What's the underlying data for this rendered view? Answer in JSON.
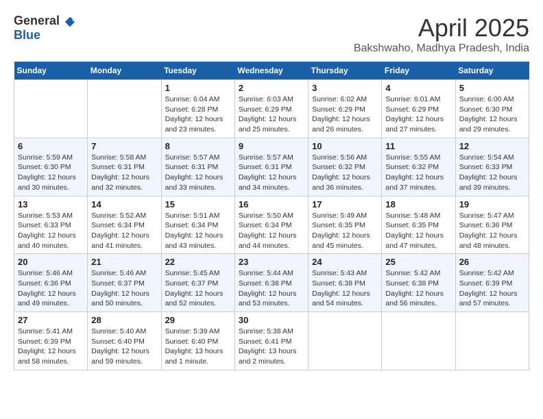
{
  "header": {
    "logo_general": "General",
    "logo_blue": "Blue",
    "month_title": "April 2025",
    "location": "Bakshwaho, Madhya Pradesh, India"
  },
  "calendar": {
    "days_of_week": [
      "Sunday",
      "Monday",
      "Tuesday",
      "Wednesday",
      "Thursday",
      "Friday",
      "Saturday"
    ],
    "weeks": [
      [
        {
          "day": "",
          "info": ""
        },
        {
          "day": "",
          "info": ""
        },
        {
          "day": "1",
          "info": "Sunrise: 6:04 AM\nSunset: 6:28 PM\nDaylight: 12 hours and 23 minutes."
        },
        {
          "day": "2",
          "info": "Sunrise: 6:03 AM\nSunset: 6:29 PM\nDaylight: 12 hours and 25 minutes."
        },
        {
          "day": "3",
          "info": "Sunrise: 6:02 AM\nSunset: 6:29 PM\nDaylight: 12 hours and 26 minutes."
        },
        {
          "day": "4",
          "info": "Sunrise: 6:01 AM\nSunset: 6:29 PM\nDaylight: 12 hours and 27 minutes."
        },
        {
          "day": "5",
          "info": "Sunrise: 6:00 AM\nSunset: 6:30 PM\nDaylight: 12 hours and 29 minutes."
        }
      ],
      [
        {
          "day": "6",
          "info": "Sunrise: 5:59 AM\nSunset: 6:30 PM\nDaylight: 12 hours and 30 minutes."
        },
        {
          "day": "7",
          "info": "Sunrise: 5:58 AM\nSunset: 6:31 PM\nDaylight: 12 hours and 32 minutes."
        },
        {
          "day": "8",
          "info": "Sunrise: 5:57 AM\nSunset: 6:31 PM\nDaylight: 12 hours and 33 minutes."
        },
        {
          "day": "9",
          "info": "Sunrise: 5:57 AM\nSunset: 6:31 PM\nDaylight: 12 hours and 34 minutes."
        },
        {
          "day": "10",
          "info": "Sunrise: 5:56 AM\nSunset: 6:32 PM\nDaylight: 12 hours and 36 minutes."
        },
        {
          "day": "11",
          "info": "Sunrise: 5:55 AM\nSunset: 6:32 PM\nDaylight: 12 hours and 37 minutes."
        },
        {
          "day": "12",
          "info": "Sunrise: 5:54 AM\nSunset: 6:33 PM\nDaylight: 12 hours and 39 minutes."
        }
      ],
      [
        {
          "day": "13",
          "info": "Sunrise: 5:53 AM\nSunset: 6:33 PM\nDaylight: 12 hours and 40 minutes."
        },
        {
          "day": "14",
          "info": "Sunrise: 5:52 AM\nSunset: 6:34 PM\nDaylight: 12 hours and 41 minutes."
        },
        {
          "day": "15",
          "info": "Sunrise: 5:51 AM\nSunset: 6:34 PM\nDaylight: 12 hours and 43 minutes."
        },
        {
          "day": "16",
          "info": "Sunrise: 5:50 AM\nSunset: 6:34 PM\nDaylight: 12 hours and 44 minutes."
        },
        {
          "day": "17",
          "info": "Sunrise: 5:49 AM\nSunset: 6:35 PM\nDaylight: 12 hours and 45 minutes."
        },
        {
          "day": "18",
          "info": "Sunrise: 5:48 AM\nSunset: 6:35 PM\nDaylight: 12 hours and 47 minutes."
        },
        {
          "day": "19",
          "info": "Sunrise: 5:47 AM\nSunset: 6:36 PM\nDaylight: 12 hours and 48 minutes."
        }
      ],
      [
        {
          "day": "20",
          "info": "Sunrise: 5:46 AM\nSunset: 6:36 PM\nDaylight: 12 hours and 49 minutes."
        },
        {
          "day": "21",
          "info": "Sunrise: 5:46 AM\nSunset: 6:37 PM\nDaylight: 12 hours and 50 minutes."
        },
        {
          "day": "22",
          "info": "Sunrise: 5:45 AM\nSunset: 6:37 PM\nDaylight: 12 hours and 52 minutes."
        },
        {
          "day": "23",
          "info": "Sunrise: 5:44 AM\nSunset: 6:38 PM\nDaylight: 12 hours and 53 minutes."
        },
        {
          "day": "24",
          "info": "Sunrise: 5:43 AM\nSunset: 6:38 PM\nDaylight: 12 hours and 54 minutes."
        },
        {
          "day": "25",
          "info": "Sunrise: 5:42 AM\nSunset: 6:38 PM\nDaylight: 12 hours and 56 minutes."
        },
        {
          "day": "26",
          "info": "Sunrise: 5:42 AM\nSunset: 6:39 PM\nDaylight: 12 hours and 57 minutes."
        }
      ],
      [
        {
          "day": "27",
          "info": "Sunrise: 5:41 AM\nSunset: 6:39 PM\nDaylight: 12 hours and 58 minutes."
        },
        {
          "day": "28",
          "info": "Sunrise: 5:40 AM\nSunset: 6:40 PM\nDaylight: 12 hours and 59 minutes."
        },
        {
          "day": "29",
          "info": "Sunrise: 5:39 AM\nSunset: 6:40 PM\nDaylight: 13 hours and 1 minute."
        },
        {
          "day": "30",
          "info": "Sunrise: 5:38 AM\nSunset: 6:41 PM\nDaylight: 13 hours and 2 minutes."
        },
        {
          "day": "",
          "info": ""
        },
        {
          "day": "",
          "info": ""
        },
        {
          "day": "",
          "info": ""
        }
      ]
    ]
  }
}
